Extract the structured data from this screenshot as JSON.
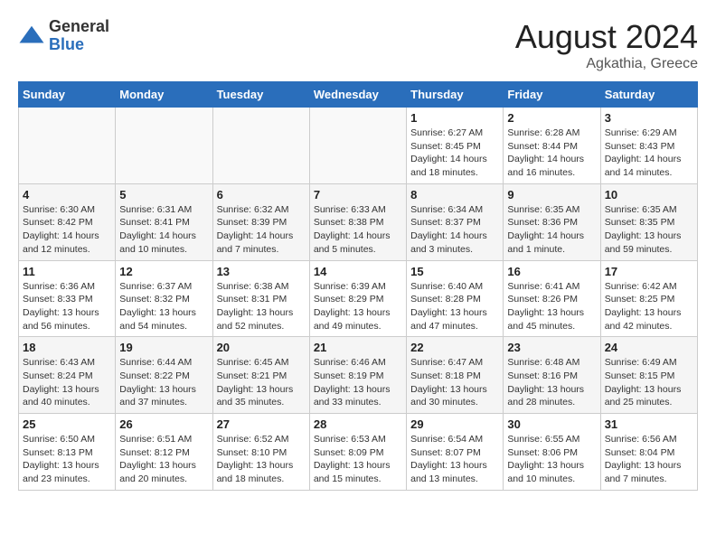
{
  "header": {
    "logo_general": "General",
    "logo_blue": "Blue",
    "main_title": "August 2024",
    "subtitle": "Agkathia, Greece"
  },
  "weekdays": [
    "Sunday",
    "Monday",
    "Tuesday",
    "Wednesday",
    "Thursday",
    "Friday",
    "Saturday"
  ],
  "weeks": [
    [
      {
        "day": "",
        "info": ""
      },
      {
        "day": "",
        "info": ""
      },
      {
        "day": "",
        "info": ""
      },
      {
        "day": "",
        "info": ""
      },
      {
        "day": "1",
        "info": "Sunrise: 6:27 AM\nSunset: 8:45 PM\nDaylight: 14 hours and 18 minutes."
      },
      {
        "day": "2",
        "info": "Sunrise: 6:28 AM\nSunset: 8:44 PM\nDaylight: 14 hours and 16 minutes."
      },
      {
        "day": "3",
        "info": "Sunrise: 6:29 AM\nSunset: 8:43 PM\nDaylight: 14 hours and 14 minutes."
      }
    ],
    [
      {
        "day": "4",
        "info": "Sunrise: 6:30 AM\nSunset: 8:42 PM\nDaylight: 14 hours and 12 minutes."
      },
      {
        "day": "5",
        "info": "Sunrise: 6:31 AM\nSunset: 8:41 PM\nDaylight: 14 hours and 10 minutes."
      },
      {
        "day": "6",
        "info": "Sunrise: 6:32 AM\nSunset: 8:39 PM\nDaylight: 14 hours and 7 minutes."
      },
      {
        "day": "7",
        "info": "Sunrise: 6:33 AM\nSunset: 8:38 PM\nDaylight: 14 hours and 5 minutes."
      },
      {
        "day": "8",
        "info": "Sunrise: 6:34 AM\nSunset: 8:37 PM\nDaylight: 14 hours and 3 minutes."
      },
      {
        "day": "9",
        "info": "Sunrise: 6:35 AM\nSunset: 8:36 PM\nDaylight: 14 hours and 1 minute."
      },
      {
        "day": "10",
        "info": "Sunrise: 6:35 AM\nSunset: 8:35 PM\nDaylight: 13 hours and 59 minutes."
      }
    ],
    [
      {
        "day": "11",
        "info": "Sunrise: 6:36 AM\nSunset: 8:33 PM\nDaylight: 13 hours and 56 minutes."
      },
      {
        "day": "12",
        "info": "Sunrise: 6:37 AM\nSunset: 8:32 PM\nDaylight: 13 hours and 54 minutes."
      },
      {
        "day": "13",
        "info": "Sunrise: 6:38 AM\nSunset: 8:31 PM\nDaylight: 13 hours and 52 minutes."
      },
      {
        "day": "14",
        "info": "Sunrise: 6:39 AM\nSunset: 8:29 PM\nDaylight: 13 hours and 49 minutes."
      },
      {
        "day": "15",
        "info": "Sunrise: 6:40 AM\nSunset: 8:28 PM\nDaylight: 13 hours and 47 minutes."
      },
      {
        "day": "16",
        "info": "Sunrise: 6:41 AM\nSunset: 8:26 PM\nDaylight: 13 hours and 45 minutes."
      },
      {
        "day": "17",
        "info": "Sunrise: 6:42 AM\nSunset: 8:25 PM\nDaylight: 13 hours and 42 minutes."
      }
    ],
    [
      {
        "day": "18",
        "info": "Sunrise: 6:43 AM\nSunset: 8:24 PM\nDaylight: 13 hours and 40 minutes."
      },
      {
        "day": "19",
        "info": "Sunrise: 6:44 AM\nSunset: 8:22 PM\nDaylight: 13 hours and 37 minutes."
      },
      {
        "day": "20",
        "info": "Sunrise: 6:45 AM\nSunset: 8:21 PM\nDaylight: 13 hours and 35 minutes."
      },
      {
        "day": "21",
        "info": "Sunrise: 6:46 AM\nSunset: 8:19 PM\nDaylight: 13 hours and 33 minutes."
      },
      {
        "day": "22",
        "info": "Sunrise: 6:47 AM\nSunset: 8:18 PM\nDaylight: 13 hours and 30 minutes."
      },
      {
        "day": "23",
        "info": "Sunrise: 6:48 AM\nSunset: 8:16 PM\nDaylight: 13 hours and 28 minutes."
      },
      {
        "day": "24",
        "info": "Sunrise: 6:49 AM\nSunset: 8:15 PM\nDaylight: 13 hours and 25 minutes."
      }
    ],
    [
      {
        "day": "25",
        "info": "Sunrise: 6:50 AM\nSunset: 8:13 PM\nDaylight: 13 hours and 23 minutes."
      },
      {
        "day": "26",
        "info": "Sunrise: 6:51 AM\nSunset: 8:12 PM\nDaylight: 13 hours and 20 minutes."
      },
      {
        "day": "27",
        "info": "Sunrise: 6:52 AM\nSunset: 8:10 PM\nDaylight: 13 hours and 18 minutes."
      },
      {
        "day": "28",
        "info": "Sunrise: 6:53 AM\nSunset: 8:09 PM\nDaylight: 13 hours and 15 minutes."
      },
      {
        "day": "29",
        "info": "Sunrise: 6:54 AM\nSunset: 8:07 PM\nDaylight: 13 hours and 13 minutes."
      },
      {
        "day": "30",
        "info": "Sunrise: 6:55 AM\nSunset: 8:06 PM\nDaylight: 13 hours and 10 minutes."
      },
      {
        "day": "31",
        "info": "Sunrise: 6:56 AM\nSunset: 8:04 PM\nDaylight: 13 hours and 7 minutes."
      }
    ]
  ]
}
